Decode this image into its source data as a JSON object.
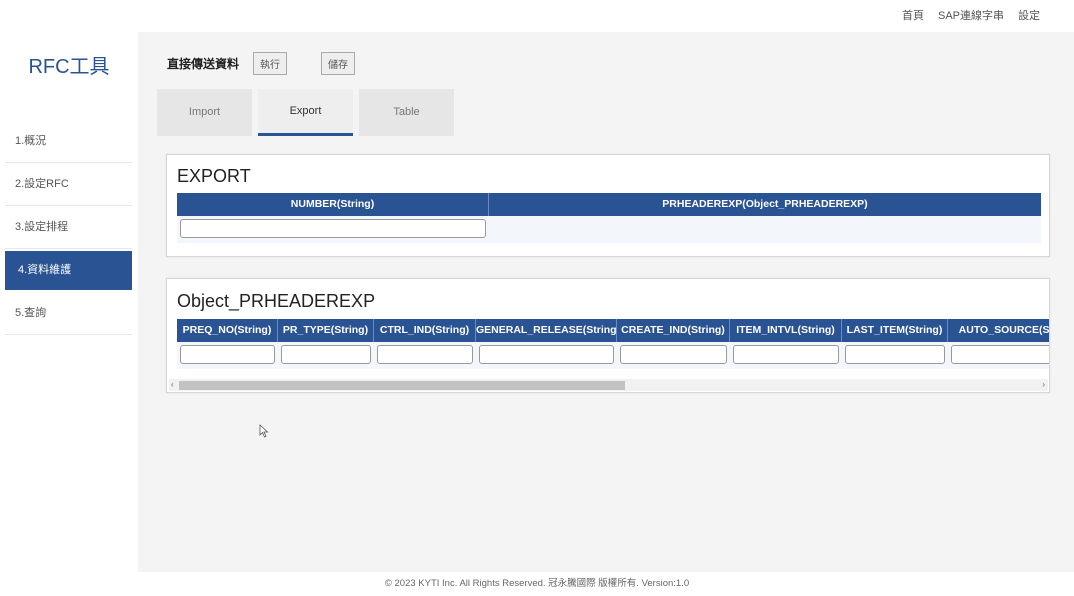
{
  "topnav": {
    "home": "首頁",
    "sap_conn": "SAP連線字串",
    "settings": "設定"
  },
  "brand": "RFC工具",
  "sidebar": {
    "items": [
      {
        "label": "1.概況"
      },
      {
        "label": "2.設定RFC"
      },
      {
        "label": "3.設定排程"
      },
      {
        "label": "4.資料維護"
      },
      {
        "label": "5.查詢"
      }
    ]
  },
  "header": {
    "title": "直接傳送資料",
    "run_label": "執行",
    "save_label": "儲存"
  },
  "tabs": [
    {
      "label": "Import"
    },
    {
      "label": "Export"
    },
    {
      "label": "Table"
    }
  ],
  "export_panel": {
    "title": "EXPORT",
    "columns": [
      "NUMBER(String)",
      "PRHEADEREXP(Object_PRHEADEREXP)"
    ]
  },
  "object_panel": {
    "title": "Object_PRHEADEREXP",
    "columns": [
      "PREQ_NO(String)",
      "PR_TYPE(String)",
      "CTRL_IND(String)",
      "GENERAL_RELEASE(String)",
      "CREATE_IND(String)",
      "ITEM_INTVL(String)",
      "LAST_ITEM(String)",
      "AUTO_SOURCE(String)"
    ]
  },
  "footer": "© 2023 KYTI Inc. All Rights Reserved. 冠永騰國際 版權所有. Version:1.0",
  "colors": {
    "primary": "#2a5394",
    "background": "#f4f4f4"
  }
}
